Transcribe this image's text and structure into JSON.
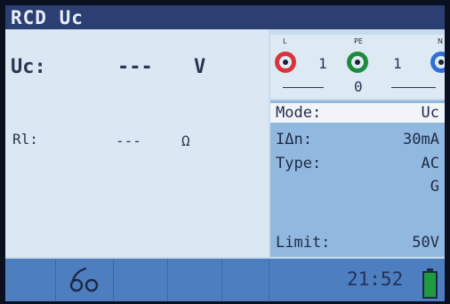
{
  "title": "RCD Uc",
  "measurement": {
    "uc_label": "Uc:",
    "uc_value": "---",
    "uc_unit": "V",
    "rl_label": "Rl:",
    "rl_value": "---",
    "rl_unit": "Ω"
  },
  "terminals": {
    "l_tag": "L",
    "pe_tag": "PE",
    "n_tag": "N",
    "l_pe_status": "1",
    "pe_n_status": "1",
    "l_n_status": "0",
    "colors": {
      "l": "#d8343c",
      "pe": "#1d8a3c",
      "n": "#2f6fd6"
    }
  },
  "parameters": [
    {
      "label": "Mode:",
      "value": "Uc",
      "selected": true
    },
    {
      "label": "IΔn:",
      "value": "30mA",
      "selected": false
    },
    {
      "label": "Type:",
      "value": "AC",
      "selected": false
    },
    {
      "label": "",
      "value": "G",
      "selected": false
    },
    {
      "label": "Limit:",
      "value": "50V",
      "selected": false
    }
  ],
  "status": {
    "clock": "21:52",
    "battery_icon": "battery-full-icon",
    "battery_color": "#1e9b3f",
    "probe_icon": "test-leads-icon"
  },
  "colors": {
    "title_bar": "#2b3f73",
    "screen_bg": "#c9dcec",
    "param_panel": "#91b8de",
    "bottom_bar": "#4d7fc0"
  }
}
